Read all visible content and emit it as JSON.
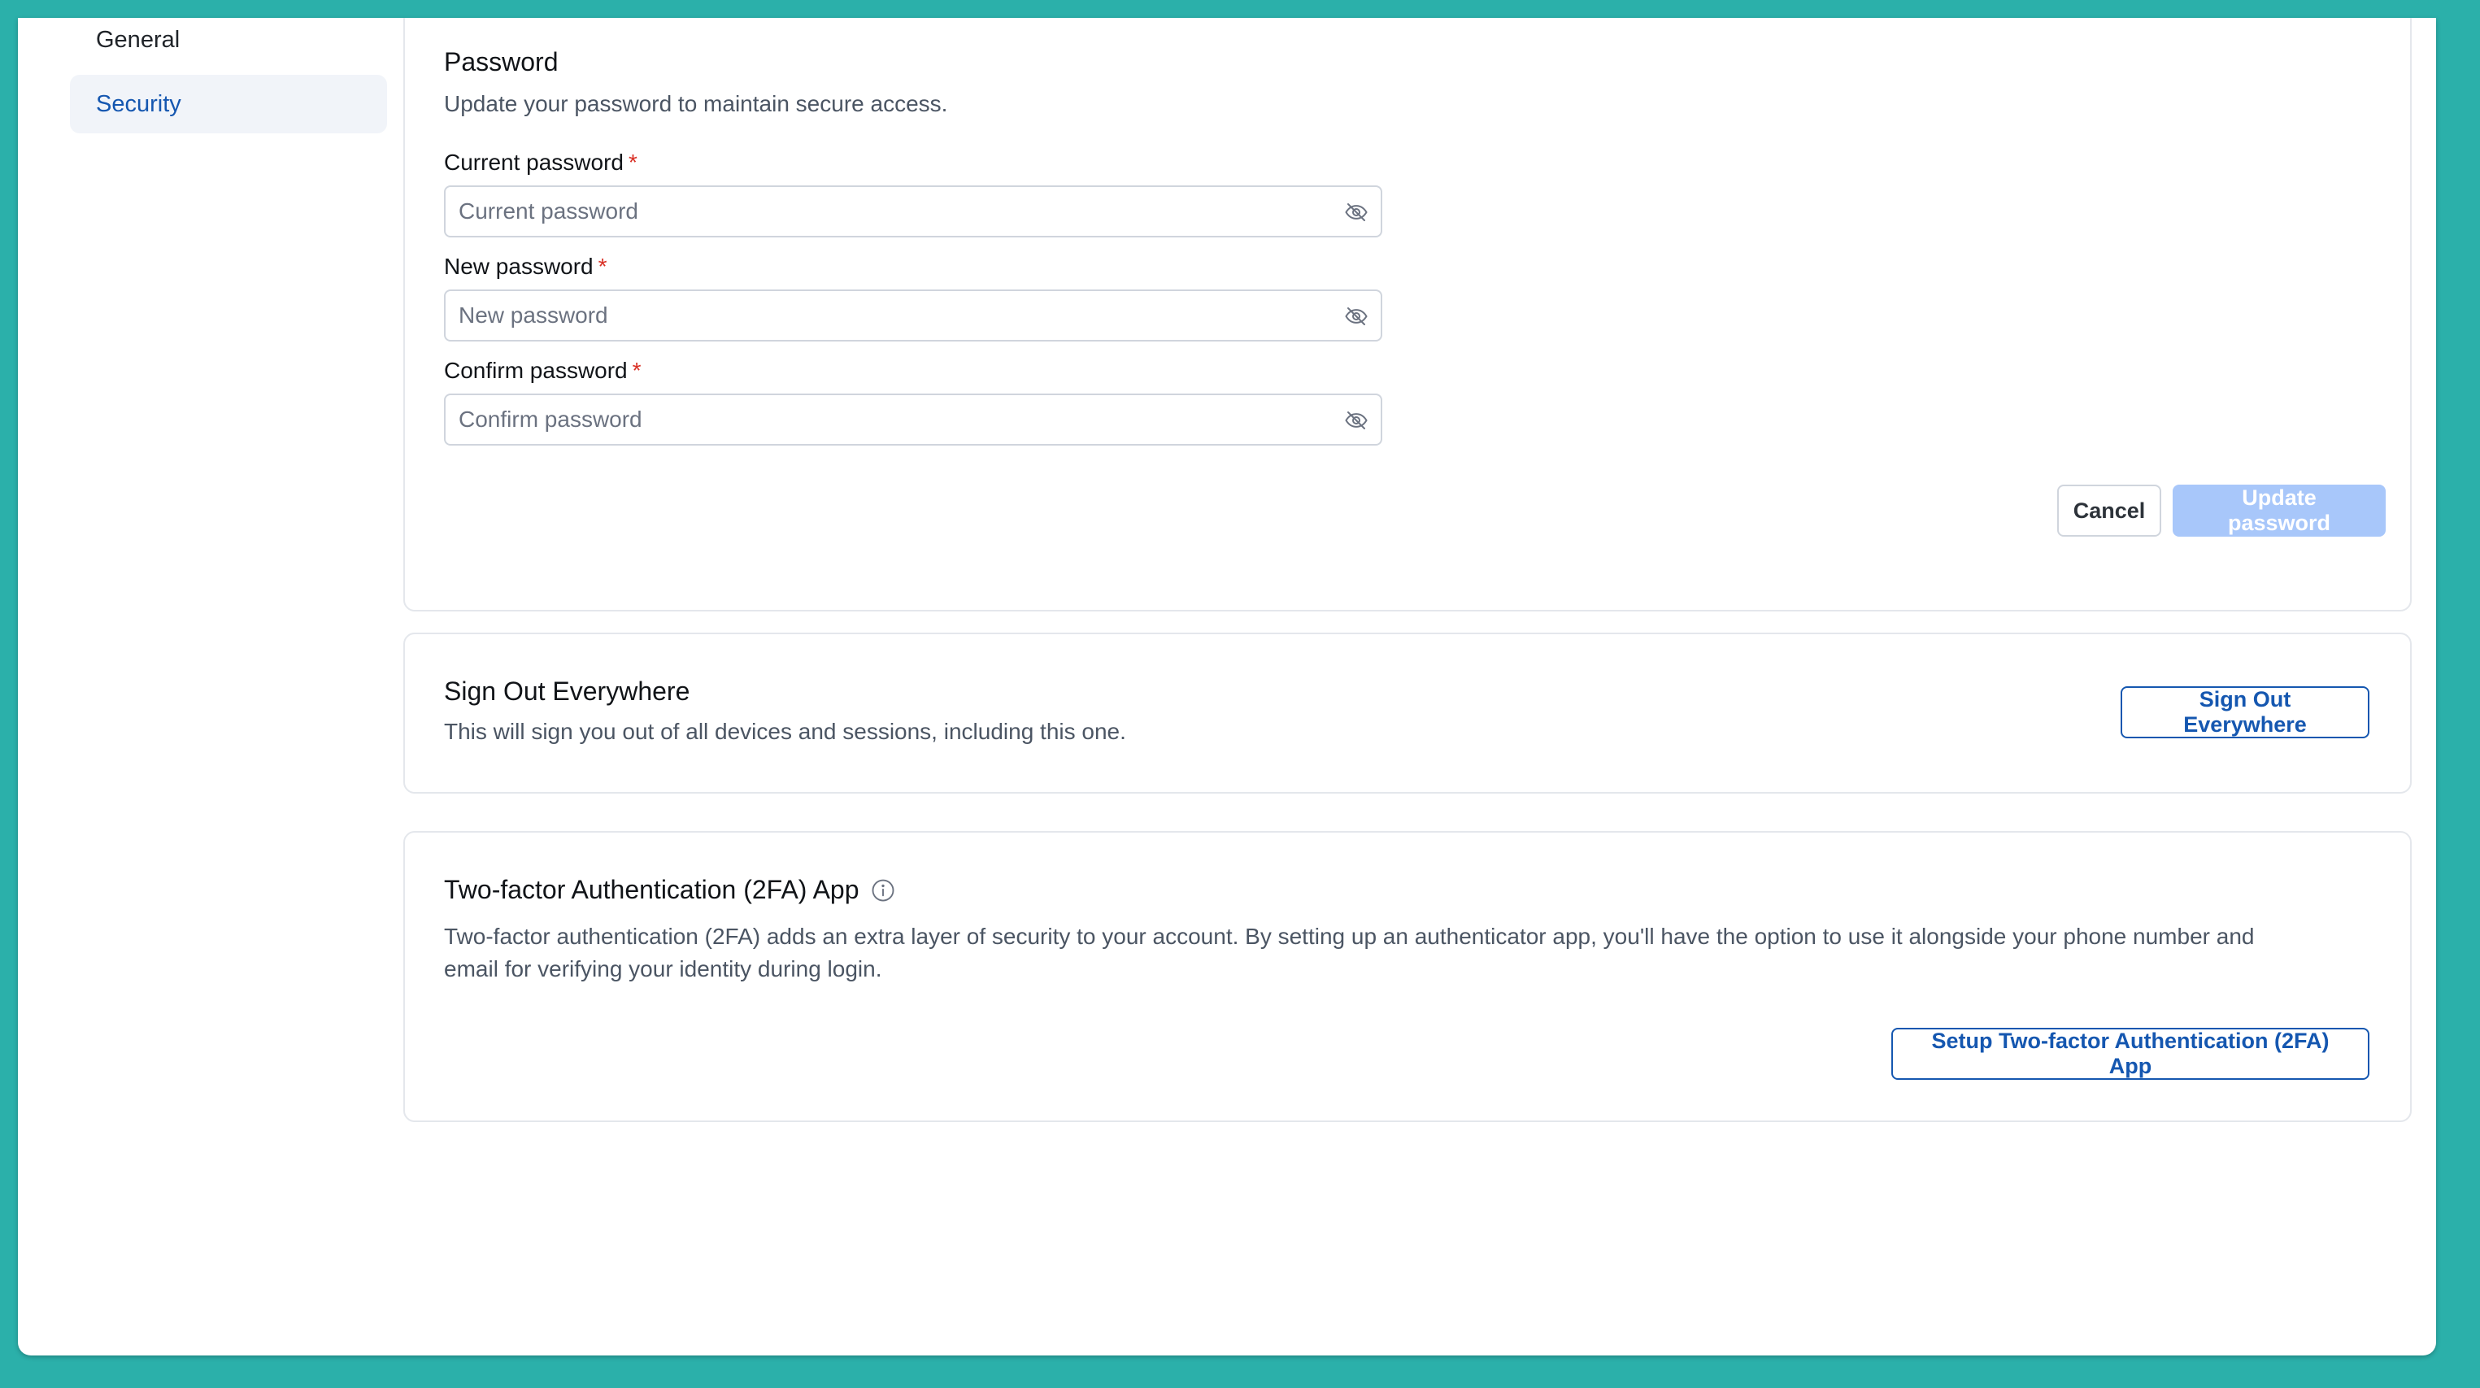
{
  "sidebar": {
    "items": [
      {
        "label": "General",
        "active": false
      },
      {
        "label": "Security",
        "active": true
      }
    ]
  },
  "password": {
    "title": "Password",
    "description": "Update your password to maintain secure access.",
    "fields": [
      {
        "label": "Current password",
        "placeholder": "Current password",
        "value": "",
        "required_mark": "*",
        "icon": "eye-off-icon"
      },
      {
        "label": "New password",
        "placeholder": "New password",
        "value": "",
        "required_mark": "*",
        "icon": "eye-off-icon"
      },
      {
        "label": "Confirm password",
        "placeholder": "Confirm password",
        "value": "",
        "required_mark": "*",
        "icon": "eye-off-icon"
      }
    ],
    "cancel_label": "Cancel",
    "update_label": "Update password",
    "update_disabled": true
  },
  "signout": {
    "title": "Sign Out Everywhere",
    "description": "This will sign you out of all devices and sessions, including this one.",
    "button_label": "Sign Out Everywhere"
  },
  "twofa": {
    "title": "Two-factor Authentication (2FA) App",
    "title_icon": "info-icon",
    "description_line1": "Two-factor authentication (2FA) adds an extra layer of security to your account. By setting up an authenticator app, you'll have the option to use it alongside your phone number and",
    "description_line2": "email for verifying your identity during login.",
    "button_label": "Setup Two-factor Authentication (2FA) App"
  },
  "colors": {
    "background": "#2bb0aa",
    "accent": "#1557b0",
    "active_nav_bg": "#f1f4f9",
    "disabled_button": "#a8c7fa",
    "required": "#d93025"
  }
}
